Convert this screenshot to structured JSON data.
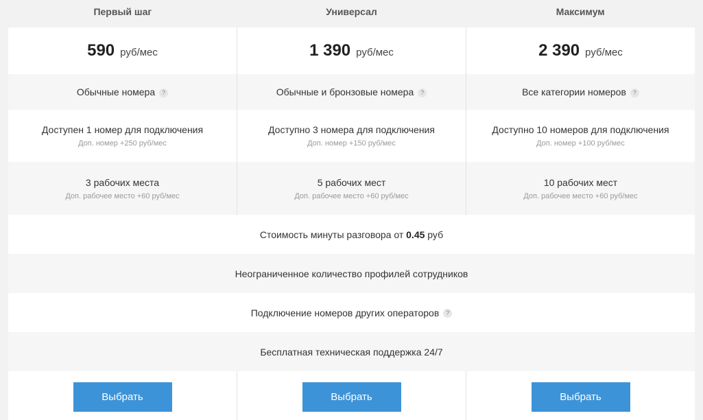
{
  "plans": [
    {
      "name": "Первый шаг",
      "price": "590",
      "unit": "руб/мес",
      "category": "Обычные номера",
      "numbers": "Доступен 1 номер для подключения",
      "numbers_extra": "Доп. номер +250 руб/мес",
      "seats": "3 рабочих места",
      "seats_extra": "Доп. рабочее место +60 руб/мес",
      "button": "Выбрать"
    },
    {
      "name": "Универсал",
      "price": "1 390",
      "unit": "руб/мес",
      "category": "Обычные и бронзовые номера",
      "numbers": "Доступно 3 номера для подключения",
      "numbers_extra": "Доп. номер +150 руб/мес",
      "seats": "5 рабочих мест",
      "seats_extra": "Доп. рабочее место +60 руб/мес",
      "button": "Выбрать"
    },
    {
      "name": "Максимум",
      "price": "2 390",
      "unit": "руб/мес",
      "category": "Все категории номеров",
      "numbers": "Доступно 10 номеров для подключения",
      "numbers_extra": "Доп. номер +100 руб/мес",
      "seats": "10 рабочих мест",
      "seats_extra": "Доп. рабочее место +60 руб/мес",
      "button": "Выбрать"
    }
  ],
  "shared": {
    "call_cost_prefix": "Стоимость минуты разговора от",
    "call_cost_value": "0.45",
    "call_cost_suffix": "руб",
    "profiles": "Неограниченное количество профилей сотрудников",
    "other_operators": "Подключение номеров других операторов",
    "support": "Бесплатная техническая поддержка 24/7"
  },
  "help_glyph": "?",
  "colors": {
    "button": "#3d93d8",
    "background": "#f2f2f2"
  }
}
